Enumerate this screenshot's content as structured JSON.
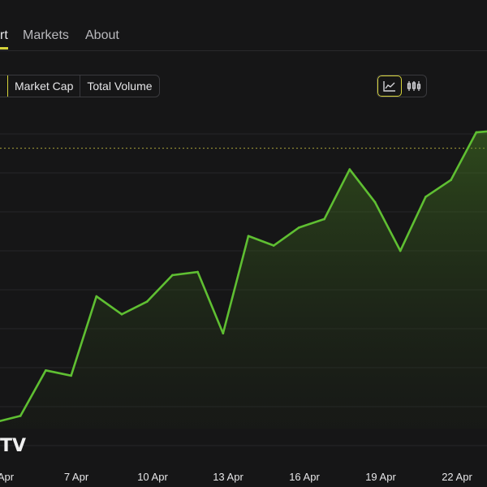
{
  "tabs": [
    {
      "label": "rt",
      "active": true
    },
    {
      "label": "Markets",
      "active": false
    },
    {
      "label": "About",
      "active": false
    }
  ],
  "metric_buttons": [
    {
      "label": "",
      "active": true
    },
    {
      "label": "Market Cap",
      "active": false
    },
    {
      "label": "Total Volume",
      "active": false
    }
  ],
  "chart_types": [
    {
      "icon": "line-chart-icon",
      "active": true
    },
    {
      "icon": "candlestick-icon",
      "active": false
    }
  ],
  "colors": {
    "background": "#161617",
    "line": "#5fbf32",
    "accent": "#d6d43a",
    "grid": "#262628"
  },
  "watermark": "TV",
  "chart_data": {
    "type": "area",
    "title": "",
    "xlabel": "",
    "ylabel": "",
    "x_tick_labels": [
      "Apr",
      "7 Apr",
      "10 Apr",
      "13 Apr",
      "16 Apr",
      "19 Apr",
      "22 Apr"
    ],
    "x": [
      "Apr 4",
      "Apr 5",
      "Apr 6",
      "Apr 7",
      "Apr 8",
      "Apr 9",
      "Apr 10",
      "Apr 11",
      "Apr 12",
      "Apr 13",
      "Apr 14",
      "Apr 15",
      "Apr 16",
      "Apr 17",
      "Apr 18",
      "Apr 19",
      "Apr 20",
      "Apr 21",
      "Apr 22",
      "Apr 23",
      "Apr 24"
    ],
    "values": [
      6,
      12,
      55,
      50,
      125,
      108,
      120,
      145,
      148,
      90,
      182,
      173,
      190,
      198,
      245,
      214,
      168,
      219,
      235,
      280,
      282
    ],
    "reference_line": 265,
    "grid": true,
    "legend": "none"
  }
}
